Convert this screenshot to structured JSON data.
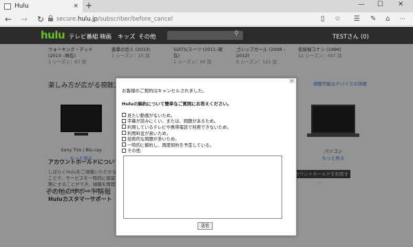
{
  "browser": {
    "tab_title": "Hulu",
    "tab_close": "×",
    "new_tab": "+",
    "win_min": "—",
    "win_max": "☐",
    "win_close": "✕",
    "back": "←",
    "forward": "→",
    "refresh": "↻",
    "url_prefix": "secure.",
    "url_domain": "hulu.jp",
    "url_path": "/subscriber/before_cancel",
    "reading": "▯",
    "favorite": "☆",
    "hub": "☰",
    "note": "✎",
    "share": "⌂",
    "more": "···"
  },
  "hulu": {
    "logo": "hulu",
    "nav": [
      "テレビ番組",
      "映画",
      "キッズ",
      "その他"
    ],
    "search_icon": "⚲",
    "user": "TESTさん (0)"
  },
  "shows": [
    {
      "title": "ウォーキング・デッド (2010 –現在)",
      "sub": "1 シーズン：87 話"
    },
    {
      "title": "進撃の巨人 (2013)",
      "sub": "1 シーズン：25 話"
    },
    {
      "title": "SUITS/スーツ (2011–現在)",
      "sub": "1 シーズン：90 話"
    },
    {
      "title": "ゴシップガール (2008 –2012)",
      "sub": "6 シーズン：121 話"
    },
    {
      "title": "名探偵コナン (1996)",
      "sub": "12 シーズン：497 話"
    }
  ],
  "page": {
    "devices_title": "楽しみ方が広がる視聴方法",
    "devices_link": "視聴可能なデバイスの詳細",
    "device_left_label": "Sony TVs / Blu-ray",
    "device_left_more": "もっと見る",
    "device_right_label": "パソコン",
    "device_right_more": "もっと見る",
    "support_title": "その他のサポート情報",
    "hold_title": "アカウントホールドについて",
    "hold_text": "しばらくHuluをご視聴いただかないことで、サービスを一時的に保留状態にすることができ、視聴を再開できます。ご全額：1ヶ月間",
    "hold_button": "アカウントホールドを利用する",
    "cs_title": "Huluカスタマーサポート"
  },
  "modal": {
    "close": "×",
    "heading": "お客様のご契約はキャンセルされました。",
    "question": "Huluの解約について簡単なご質問にお答えください。",
    "options": [
      "見たい動画がないため。",
      "字幕が読みにくい、または、問題があるため。",
      "利用しているテレビや携帯電話で利用できないため。",
      "利用料金が高いため。",
      "技術的な問題が多いため。",
      "一時的に解約し、再度契約を予定している。",
      "その他"
    ],
    "textarea_value": "",
    "submit": "送信"
  }
}
